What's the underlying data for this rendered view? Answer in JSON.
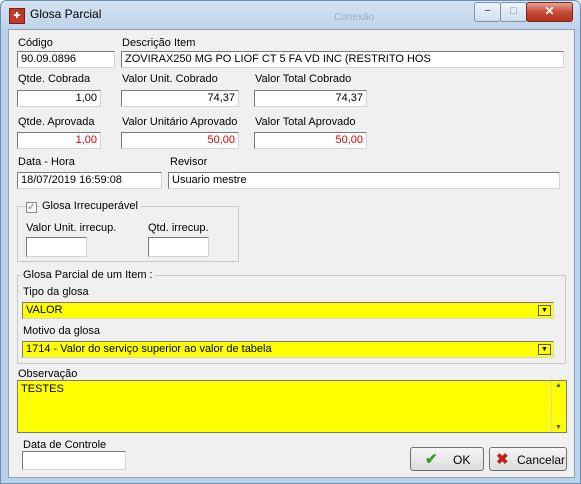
{
  "window": {
    "title": "Glosa Parcial",
    "ghost_text": "Conexão"
  },
  "titlebar_buttons": {
    "minimize": "−",
    "maximize": "□",
    "close": "✕"
  },
  "fields": {
    "codigo": {
      "label": "Código",
      "value": "90.09.0896"
    },
    "descricao": {
      "label": "Descrição Item",
      "value": "ZOVIRAX250 MG PO LIOF CT 5 FA VD INC (RESTRITO HOS"
    },
    "qtde_cobrada": {
      "label": "Qtde. Cobrada",
      "value": "1,00"
    },
    "valor_unit_cobrado": {
      "label": "Valor Unit. Cobrado",
      "value": "74,37"
    },
    "valor_total_cobrado": {
      "label": "Valor Total Cobrado",
      "value": "74,37"
    },
    "qtde_aprovada": {
      "label": "Qtde. Aprovada",
      "value": "1,00"
    },
    "valor_unit_aprovado": {
      "label": "Valor Unitário Aprovado",
      "value": "50,00"
    },
    "valor_total_aprovado": {
      "label": "Valor Total Aprovado",
      "value": "50,00"
    },
    "data_hora": {
      "label": "Data - Hora",
      "value": "18/07/2019  16:59:08"
    },
    "revisor": {
      "label": "Revisor",
      "value": "Usuario mestre"
    }
  },
  "irrecuperavel": {
    "checkbox_label": "Glosa Irrecuperável",
    "checked": true,
    "valor_unit_label": "Valor Unit. irrecup.",
    "valor_unit_value": "",
    "qtd_label": "Qtd. irrecup.",
    "qtd_value": ""
  },
  "glosa_item": {
    "group_title": "Glosa Parcial de um Item :",
    "tipo_label": "Tipo da glosa",
    "tipo_value": "VALOR",
    "motivo_label": "Motivo da glosa",
    "motivo_value": "1714 - Valor do serviço superior ao valor de tabela"
  },
  "observacao": {
    "label": "Observação",
    "value": "TESTES"
  },
  "data_controle": {
    "label": "Data de Controle",
    "value": ""
  },
  "buttons": {
    "ok": "OK",
    "cancel": "Cancelar"
  },
  "colors": {
    "highlight": "#ffff00",
    "approved_text": "#d00000",
    "ok_icon": "#2e9d1a",
    "cancel_icon": "#c0201a"
  }
}
